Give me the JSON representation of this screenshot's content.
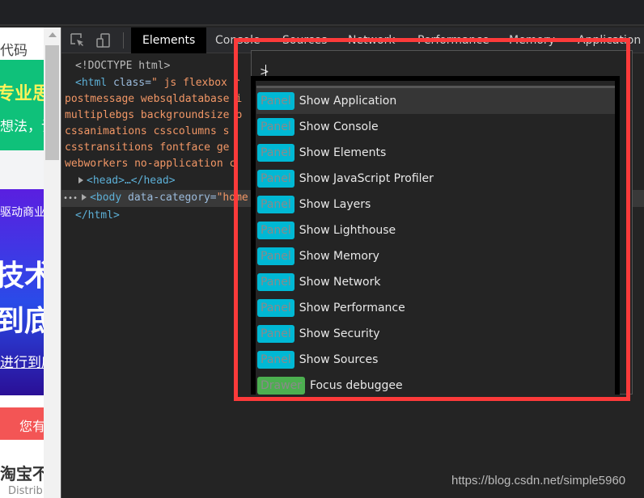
{
  "webpage": {
    "text1": "代码",
    "banner1": "专业思",
    "banner1_sub": "想法，让",
    "banner2_top": "驱动商业",
    "banner2_main1": "技术",
    "banner2_main2": "到底",
    "banner2_sub": "进行到底",
    "red_bar": "您有",
    "headline": "淘宝不",
    "subline": "Distrib"
  },
  "devtools": {
    "tabs": [
      {
        "label": "Elements",
        "active": true
      },
      {
        "label": "Console"
      },
      {
        "label": "Sources"
      },
      {
        "label": "Network"
      },
      {
        "label": "Performance"
      },
      {
        "label": "Memory"
      },
      {
        "label": "Application"
      }
    ],
    "code": {
      "doctype": "<!DOCTYPE html>",
      "html_open_tag": "<html",
      "html_attr": " class=",
      "html_val": "\" js flexbox r",
      "class_lines": [
        "postmessage websqldatabase i",
        "multiplebgs backgroundsize b",
        "cssanimations csscolumns  s",
        "csstransitions fontface ge",
        "webworkers no-application c"
      ],
      "head": "<head>…</head>",
      "body_tag": "<body",
      "body_attr": " data-category=",
      "body_val": "\"home",
      "html_close": "</html>"
    }
  },
  "command_menu": {
    "input_value": ">",
    "items": [
      {
        "badge": "Panel",
        "label": "Show Application",
        "selected": true
      },
      {
        "badge": "Panel",
        "label": "Show Console"
      },
      {
        "badge": "Panel",
        "label": "Show Elements"
      },
      {
        "badge": "Panel",
        "label": "Show JavaScript Profiler"
      },
      {
        "badge": "Panel",
        "label": "Show Layers"
      },
      {
        "badge": "Panel",
        "label": "Show Lighthouse"
      },
      {
        "badge": "Panel",
        "label": "Show Memory"
      },
      {
        "badge": "Panel",
        "label": "Show Network"
      },
      {
        "badge": "Panel",
        "label": "Show Performance"
      },
      {
        "badge": "Panel",
        "label": "Show Security"
      },
      {
        "badge": "Panel",
        "label": "Show Sources"
      },
      {
        "badge": "Drawer",
        "label": "Focus debuggee"
      }
    ],
    "colors": {
      "panel_badge": "#00b8d4",
      "drawer_badge": "#4caf50",
      "highlight_box": "#fc3a3a"
    }
  },
  "watermark": "https://blog.csdn.net/simple5960"
}
